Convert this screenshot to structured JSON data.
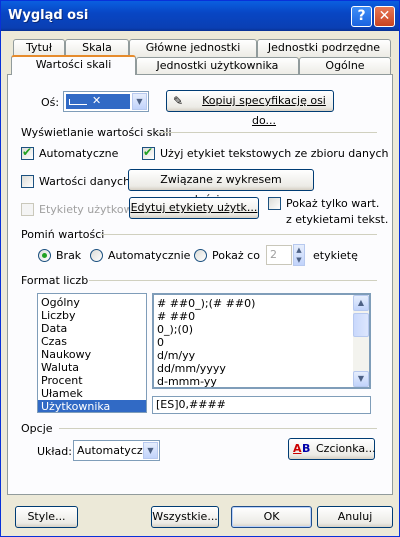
{
  "window": {
    "title": "Wygląd osi",
    "help_glyph": "?",
    "close_glyph": "✕"
  },
  "tabs_back": [
    "Tytuł",
    "Skala",
    "Główne jednostki",
    "Jednostki podrzędne"
  ],
  "tabs_front": [
    "Wartości skali",
    "Jednostki użytkownika",
    "Ogólne"
  ],
  "axis": {
    "label": "Oś:",
    "copy_button": "Kopiuj specyfikację osi do..."
  },
  "display": {
    "heading": "Wyświetlanie wartości skali",
    "automatic": "Automatyczne",
    "automatic_checked": true,
    "use_labels": "Użyj etykiet tekstowych ze zbioru danych",
    "use_labels_checked": true,
    "data_values": "Wartości danych:",
    "data_values_checked": false,
    "linked_button": "Związane z wykresem właściwym...",
    "user_labels": "Etykiety użytkow.:",
    "edit_labels_button": "Edytuj etykiety użytk...",
    "show_only_line1": "Pokaż tylko wart.",
    "show_only_line2": "z etykietami tekst."
  },
  "skip": {
    "heading": "Pomiń wartości",
    "none": "Brak",
    "auto": "Automatycznie",
    "every": "Pokaż co",
    "every_value": "2",
    "label_suffix": "etykietę",
    "selected": "none"
  },
  "format": {
    "heading": "Format liczb",
    "categories": [
      "Ogólny",
      "Liczby",
      "Data",
      "Czas",
      "Naukowy",
      "Waluta",
      "Procent",
      "Ułamek",
      "Użytkownika"
    ],
    "selected_category": "Użytkownika",
    "formats": [
      "# ##0_);(# ##0)",
      "# ##0",
      "0_);(0)",
      "0",
      "d/m/yy",
      "dd/mm/yyyy",
      "d-mmm-yy"
    ],
    "custom_value": "[ES]0,####"
  },
  "options": {
    "heading": "Opcje",
    "layout_label": "Układ:",
    "layout_value": "Automatyczni",
    "font_button": "Czcionka..."
  },
  "footer": {
    "style": "Style...",
    "all": "Wszystkie...",
    "ok": "OK",
    "cancel": "Anuluj"
  },
  "colors": {
    "title_blue": "#0a5fe0",
    "selection": "#316ac5",
    "axis_swatch": "#316ac5"
  }
}
